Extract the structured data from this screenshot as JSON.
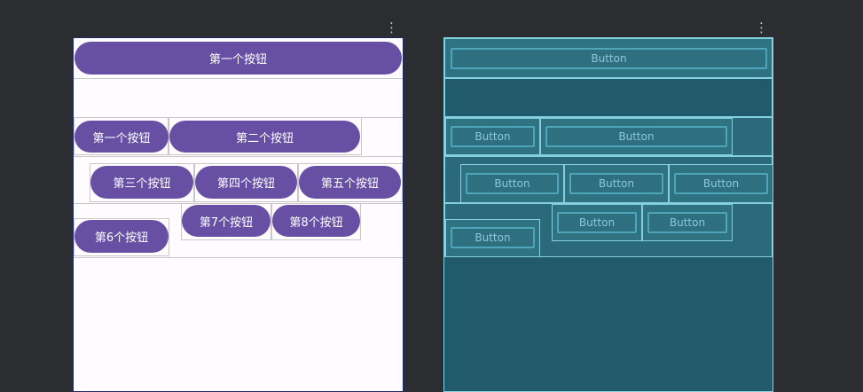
{
  "toolbar": {
    "menu_icon_glyph": "⋮"
  },
  "design": {
    "row1": {
      "button": "第一个按钮"
    },
    "row2": {},
    "row3": {
      "buttons": [
        "第一个按钮",
        "第二个按钮"
      ]
    },
    "row4": {
      "buttons": [
        "第三个按钮",
        "第四个按钮",
        "第五个按钮"
      ]
    },
    "row5": {
      "buttons": [
        "第6个按钮",
        "第7个按钮",
        "第8个按钮"
      ]
    }
  },
  "blueprint": {
    "button_label": "Button"
  },
  "colors": {
    "background": "#2b2d30",
    "primary": "#6750a4",
    "blueprint_bg": "#215b6b",
    "blueprint_line": "#86cfe0"
  }
}
